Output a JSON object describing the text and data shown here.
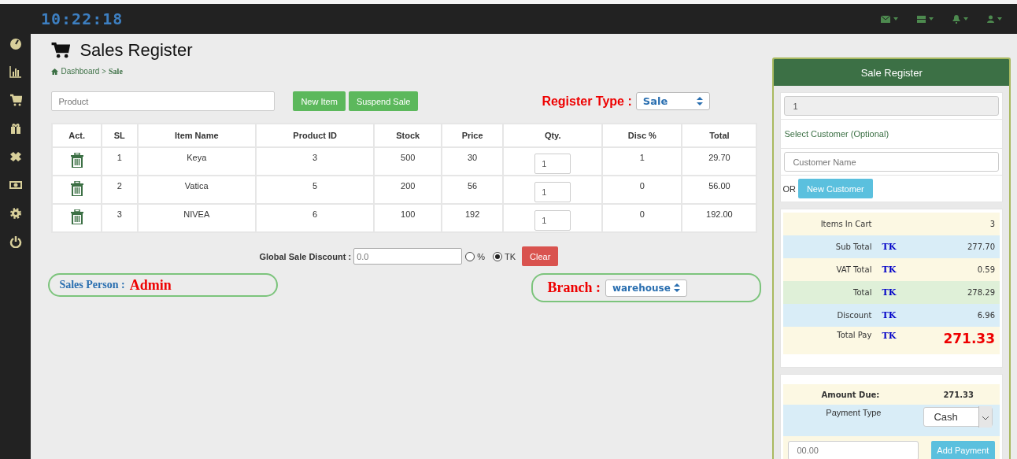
{
  "clock": "10:22:18",
  "page": {
    "title": "Sales Register",
    "breadcrumb": {
      "link": "Dashboard",
      "separator": ">",
      "current": "Sale"
    }
  },
  "toolbar": {
    "product_placeholder": "Product",
    "buttons": [
      "New Item",
      "Suspend Sale"
    ],
    "register_type_label": "Register Type :",
    "register_type": "Sale"
  },
  "table": {
    "columns": [
      "Act.",
      "SL",
      "Item Name",
      "Product ID",
      "Stock",
      "Price",
      "Qty.",
      "Disc %",
      "Total"
    ],
    "rows": [
      {
        "sl": "1",
        "item_name": "Keya",
        "product_id": "3",
        "stock": "500",
        "price": "30",
        "qty": "1",
        "disc": "1",
        "total": "29.70"
      },
      {
        "sl": "2",
        "item_name": "Vatica",
        "product_id": "5",
        "stock": "200",
        "price": "56",
        "qty": "1",
        "disc": "0",
        "total": "56.00"
      },
      {
        "sl": "3",
        "item_name": "NIVEA",
        "product_id": "6",
        "stock": "100",
        "price": "192",
        "qty": "1",
        "disc": "0",
        "total": "192.00"
      }
    ]
  },
  "discount": {
    "label": "Global Sale Discount :",
    "placeholder": "0.0",
    "options": [
      {
        "label": "%",
        "selected": false
      },
      {
        "label": "TK",
        "selected": true
      }
    ],
    "clear": "Clear"
  },
  "sales_person": {
    "label": "Sales Person :",
    "value": "Admin"
  },
  "branch": {
    "label": "Branch :",
    "value": "warehouse"
  },
  "register": {
    "title": "Sale Register",
    "register_no": "1",
    "customer_label": "Select Customer (Optional)",
    "customer_placeholder": "Customer Name",
    "or": "OR",
    "new_customer": "New Customer",
    "summary": [
      {
        "kind": "warning",
        "label": "Items In Cart",
        "value": "3"
      },
      {
        "kind": "info",
        "label": "Sub Total",
        "currency": "TK",
        "value": "277.70"
      },
      {
        "kind": "warning",
        "label": "VAT Total",
        "currency": "TK",
        "value": "0.59"
      },
      {
        "kind": "success",
        "label": "Total",
        "currency": "TK",
        "value": "278.29"
      },
      {
        "kind": "info",
        "label": "Discount",
        "currency": "TK",
        "value": "6.96"
      },
      {
        "kind": "total",
        "label": "Total Pay",
        "currency": "TK",
        "value": "271.33"
      }
    ]
  },
  "payment": {
    "amount_due_label": "Amount Due:",
    "amount_due": "271.33",
    "payment_type_label": "Payment Type",
    "payment_type": "Cash",
    "amount_placeholder": "00.00",
    "add_payment": "Add Payment"
  }
}
